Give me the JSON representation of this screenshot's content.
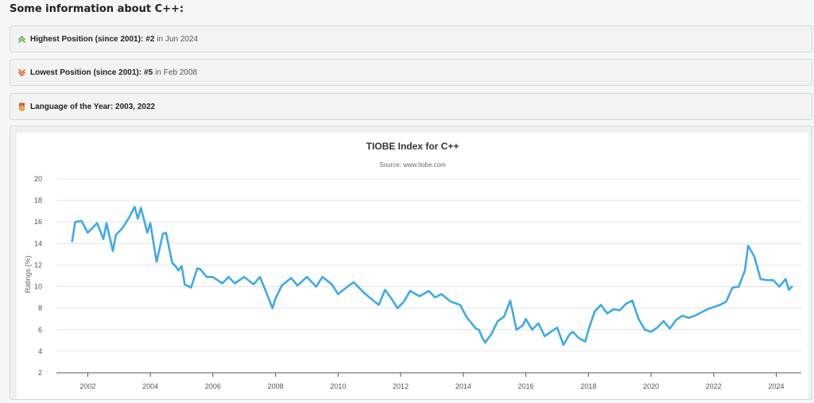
{
  "section_title": "Some information about C++:",
  "info": {
    "highest": {
      "icon": "double-chevron-up-icon",
      "label": "Highest Position (since 2001):",
      "value": "#2",
      "date": "in Jun 2024",
      "color": "#5cb85c"
    },
    "lowest": {
      "icon": "double-chevron-down-icon",
      "label": "Lowest Position (since 2001):",
      "value": "#5",
      "date": "in Feb 2008",
      "color": "#e8622c"
    },
    "year": {
      "icon": "medal-icon",
      "label": "Language of the Year: 2003, 2022"
    }
  },
  "chart_data": {
    "type": "line",
    "title": "TIOBE Index for C++",
    "subtitle": "Source: www.tiobe.com",
    "xlabel": "",
    "ylabel": "Ratings (%)",
    "ylim": [
      2,
      20
    ],
    "yticks": [
      2,
      4,
      6,
      8,
      10,
      12,
      14,
      16,
      18,
      20
    ],
    "xlim": [
      2001.0,
      2024.8
    ],
    "xticks": [
      2002,
      2004,
      2006,
      2008,
      2010,
      2012,
      2014,
      2016,
      2018,
      2020,
      2022,
      2024
    ],
    "grid": true,
    "legend": "none",
    "color": "#3daae9",
    "series": [
      {
        "name": "C++",
        "x": [
          2001.5,
          2001.6,
          2001.8,
          2002.0,
          2002.3,
          2002.5,
          2002.6,
          2002.8,
          2002.9,
          2003.1,
          2003.3,
          2003.5,
          2003.6,
          2003.7,
          2003.8,
          2003.9,
          2004.0,
          2004.2,
          2004.4,
          2004.5,
          2004.7,
          2004.8,
          2004.9,
          2005.0,
          2005.1,
          2005.3,
          2005.5,
          2005.6,
          2005.8,
          2006.0,
          2006.3,
          2006.5,
          2006.7,
          2007.0,
          2007.3,
          2007.5,
          2007.7,
          2007.9,
          2008.0,
          2008.2,
          2008.5,
          2008.7,
          2009.0,
          2009.3,
          2009.5,
          2009.8,
          2010.0,
          2010.3,
          2010.5,
          2010.8,
          2011.0,
          2011.3,
          2011.5,
          2011.7,
          2011.9,
          2012.1,
          2012.3,
          2012.6,
          2012.9,
          2013.1,
          2013.3,
          2013.6,
          2013.9,
          2014.1,
          2014.4,
          2014.5,
          2014.6,
          2014.7,
          2014.9,
          2015.1,
          2015.3,
          2015.5,
          2015.7,
          2015.9,
          2016.0,
          2016.2,
          2016.4,
          2016.6,
          2016.8,
          2017.0,
          2017.2,
          2017.4,
          2017.5,
          2017.7,
          2017.9,
          2018.0,
          2018.2,
          2018.4,
          2018.6,
          2018.8,
          2019.0,
          2019.2,
          2019.4,
          2019.6,
          2019.8,
          2020.0,
          2020.2,
          2020.4,
          2020.6,
          2020.8,
          2021.0,
          2021.2,
          2021.4,
          2021.6,
          2021.8,
          2022.0,
          2022.2,
          2022.4,
          2022.6,
          2022.8,
          2023.0,
          2023.1,
          2023.3,
          2023.5,
          2023.7,
          2023.9,
          2024.1,
          2024.3,
          2024.4,
          2024.5
        ],
        "values": [
          14.2,
          16.0,
          16.1,
          15.0,
          15.9,
          14.4,
          15.9,
          13.3,
          14.8,
          15.4,
          16.3,
          17.4,
          16.3,
          17.3,
          16.2,
          15.0,
          15.9,
          12.3,
          14.9,
          15.0,
          12.2,
          11.9,
          11.5,
          11.9,
          10.2,
          9.9,
          11.7,
          11.6,
          10.9,
          10.9,
          10.3,
          10.9,
          10.3,
          10.9,
          10.2,
          10.9,
          9.5,
          8.0,
          8.9,
          10.1,
          10.8,
          10.1,
          10.9,
          10.0,
          10.9,
          10.2,
          9.3,
          10.0,
          10.4,
          9.5,
          9.0,
          8.3,
          9.7,
          8.9,
          8.0,
          8.6,
          9.6,
          9.1,
          9.6,
          9.0,
          9.3,
          8.6,
          8.3,
          7.2,
          6.1,
          6.0,
          5.3,
          4.8,
          5.6,
          6.8,
          7.2,
          8.7,
          6.0,
          6.4,
          7.0,
          6.0,
          6.6,
          5.4,
          5.8,
          6.2,
          4.6,
          5.6,
          5.8,
          5.2,
          4.9,
          6.0,
          7.7,
          8.3,
          7.5,
          7.9,
          7.8,
          8.4,
          8.7,
          7.0,
          6.0,
          5.8,
          6.2,
          6.8,
          6.1,
          6.9,
          7.3,
          7.1,
          7.3,
          7.6,
          7.9,
          8.1,
          8.3,
          8.6,
          9.9,
          10.0,
          11.5,
          13.8,
          12.8,
          10.7,
          10.6,
          10.6,
          10.0,
          10.7,
          9.7,
          10.0
        ]
      }
    ]
  }
}
